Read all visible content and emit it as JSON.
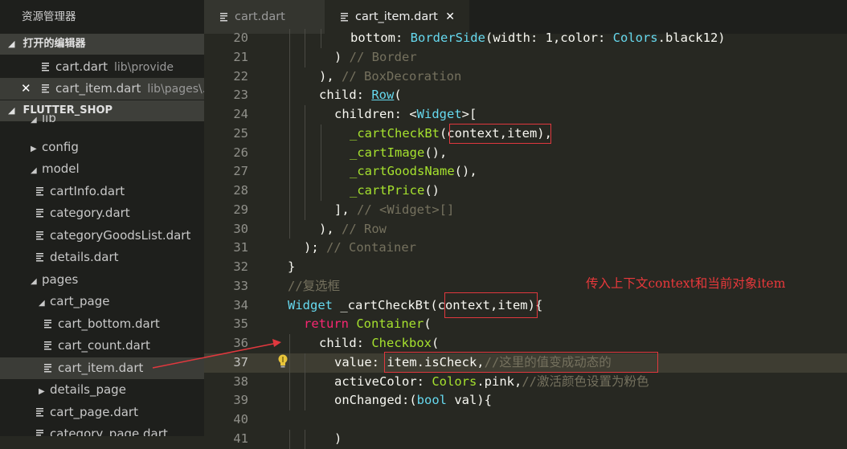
{
  "sidebar": {
    "title": "资源管理器",
    "open_editors_header": "打开的编辑器",
    "open_editors": [
      {
        "name": "cart.dart",
        "desc": "lib\\provide"
      },
      {
        "name": "cart_item.dart",
        "desc": "lib\\pages\\..."
      }
    ],
    "project_header": "FLUTTER_SHOP",
    "tree": [
      {
        "label": "lib",
        "kind": "folder-open"
      },
      {
        "label": "config",
        "kind": "folder-closed"
      },
      {
        "label": "model",
        "kind": "folder-open"
      },
      {
        "label": "cartInfo.dart",
        "kind": "file"
      },
      {
        "label": "category.dart",
        "kind": "file"
      },
      {
        "label": "categoryGoodsList.dart",
        "kind": "file"
      },
      {
        "label": "details.dart",
        "kind": "file"
      },
      {
        "label": "pages",
        "kind": "folder-open"
      },
      {
        "label": "cart_page",
        "kind": "folder-open"
      },
      {
        "label": "cart_bottom.dart",
        "kind": "file"
      },
      {
        "label": "cart_count.dart",
        "kind": "file"
      },
      {
        "label": "cart_item.dart",
        "kind": "file",
        "selected": true
      },
      {
        "label": "details_page",
        "kind": "folder-closed"
      },
      {
        "label": "cart_page.dart",
        "kind": "file"
      },
      {
        "label": "category_page.dart",
        "kind": "file"
      }
    ]
  },
  "tabs": [
    {
      "label": "cart.dart",
      "active": false
    },
    {
      "label": "cart_item.dart",
      "active": true
    }
  ],
  "editor": {
    "current_line": 37,
    "lines": [
      {
        "n": "20",
        "text": "bottom: BorderSide(width: 1,color: Colors.black12)"
      },
      {
        "n": "21",
        "text": ") // Border"
      },
      {
        "n": "22",
        "text": "), // BoxDecoration"
      },
      {
        "n": "23",
        "text": "child: Row("
      },
      {
        "n": "24",
        "text": "children: <Widget>["
      },
      {
        "n": "25",
        "text": "_cartCheckBt(context,item),"
      },
      {
        "n": "26",
        "text": "_cartImage(),"
      },
      {
        "n": "27",
        "text": "_cartGoodsName(),"
      },
      {
        "n": "28",
        "text": "_cartPrice()"
      },
      {
        "n": "29",
        "text": "], // <Widget>[]"
      },
      {
        "n": "30",
        "text": "), // Row"
      },
      {
        "n": "31",
        "text": "); // Container"
      },
      {
        "n": "32",
        "text": "}"
      },
      {
        "n": "33",
        "text": "//复选框"
      },
      {
        "n": "34",
        "text": "Widget _cartCheckBt(context,item){"
      },
      {
        "n": "35",
        "text": "return Container("
      },
      {
        "n": "36",
        "text": "child: Checkbox("
      },
      {
        "n": "37",
        "text": "value: item.isCheck,//这里的值变成动态的"
      },
      {
        "n": "38",
        "text": "activeColor: Colors.pink,//激活颜色设置为粉色"
      },
      {
        "n": "39",
        "text": "onChanged:(bool val){"
      },
      {
        "n": "40",
        "text": ""
      },
      {
        "n": "41",
        "text": ")"
      }
    ]
  },
  "annotation": "传入上下文context和当前对象item",
  "colors": {
    "sidebar_bg": "#1e1f1c",
    "editor_bg": "#272822",
    "annotation_red": "#e0383e"
  }
}
